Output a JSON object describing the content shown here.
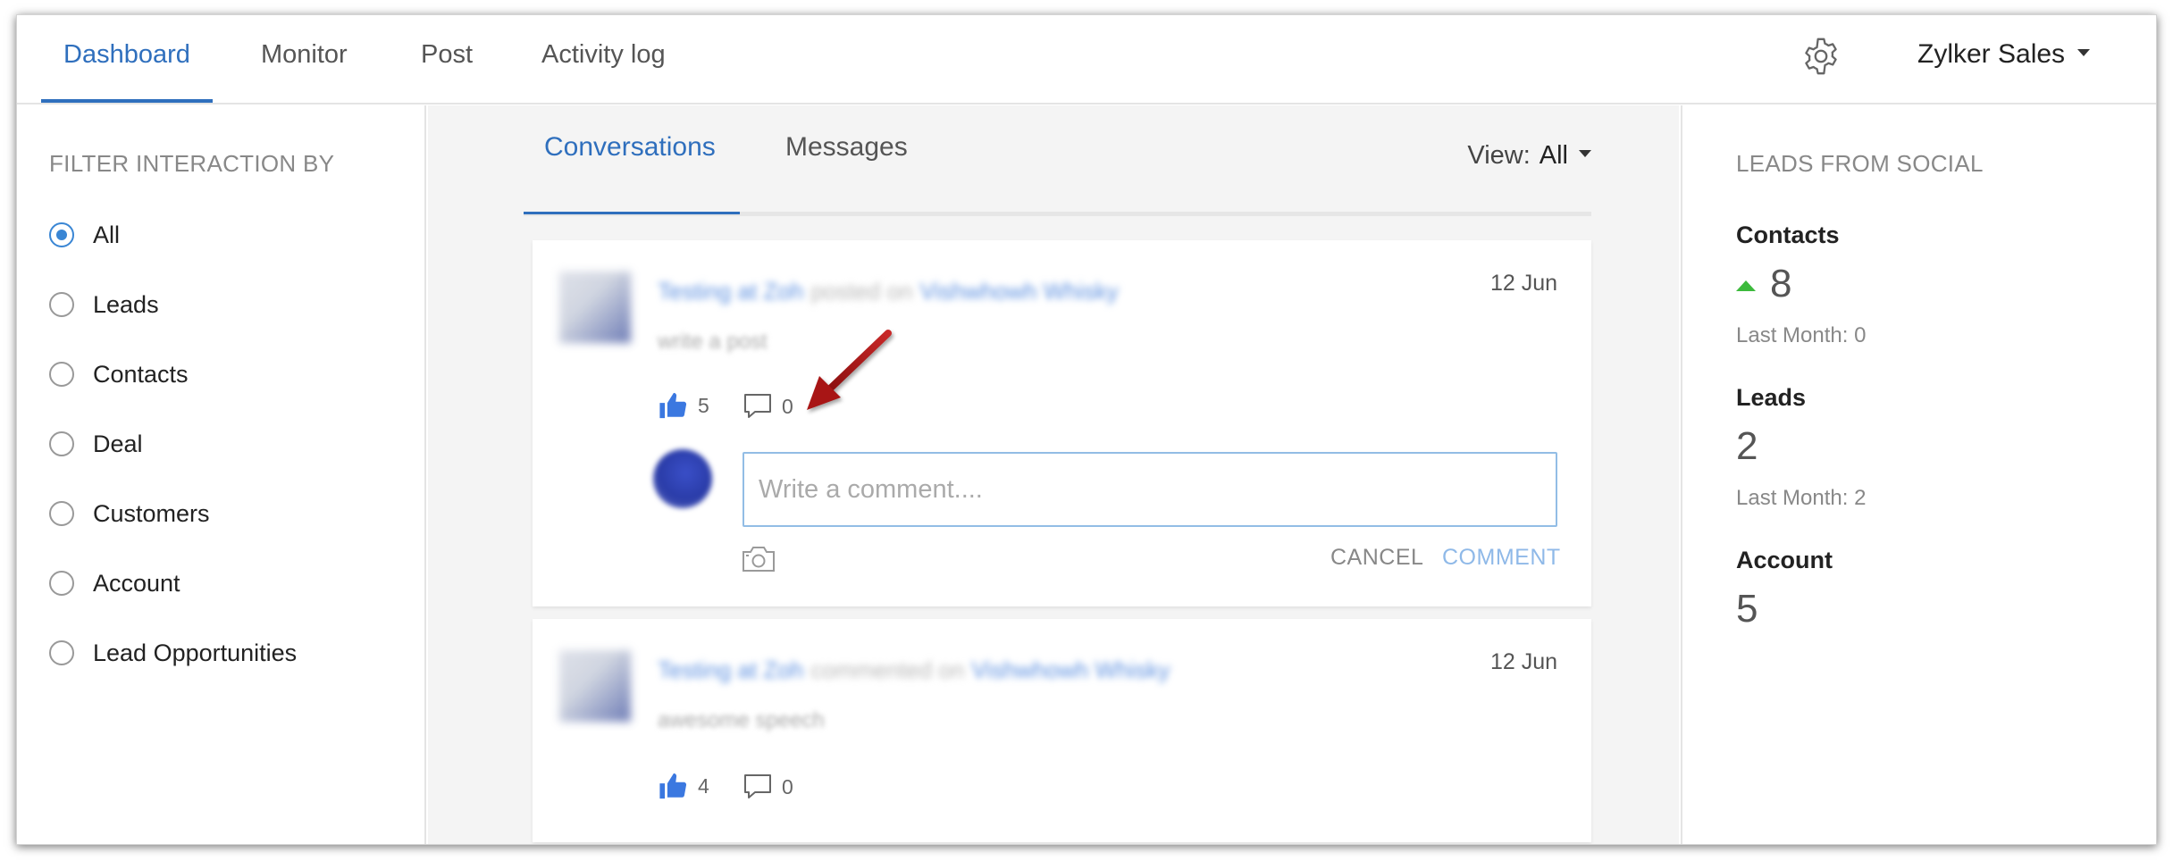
{
  "nav": {
    "tabs": [
      {
        "label": "Dashboard",
        "active": true
      },
      {
        "label": "Monitor"
      },
      {
        "label": "Post"
      },
      {
        "label": "Activity log"
      }
    ],
    "settings_icon": "gear-icon",
    "account_name": "Zylker Sales"
  },
  "filter": {
    "heading": "FILTER INTERACTION BY",
    "selected": "All",
    "options": [
      "All",
      "Leads",
      "Contacts",
      "Deal",
      "Customers",
      "Account",
      "Lead Opportunities"
    ]
  },
  "center": {
    "tabs": [
      {
        "label": "Conversations",
        "active": true
      },
      {
        "label": "Messages"
      }
    ],
    "view_label": "View:",
    "view_value": "All",
    "posts": [
      {
        "author": "Testing at Zoh",
        "action": "posted on",
        "page": "Vishwhowh Whisky",
        "body": "write a post",
        "date": "12 Jun",
        "likes": "5",
        "comments": "0",
        "composer": {
          "placeholder": "Write a comment....",
          "cancel_label": "CANCEL",
          "submit_label": "COMMENT"
        }
      },
      {
        "author": "Testing at Zoh",
        "action": "commented on",
        "page": "Vishwhowh Whisky",
        "body": "awesome speech",
        "date": "12 Jun",
        "likes": "4",
        "comments": "0"
      }
    ]
  },
  "leads_panel": {
    "heading": "LEADS FROM SOCIAL",
    "contacts": {
      "label": "Contacts",
      "value": "8",
      "trend": "up",
      "last_month": "Last Month: 0"
    },
    "leads": {
      "label": "Leads",
      "value": "2",
      "last_month": "Last Month: 2"
    },
    "account": {
      "label": "Account",
      "value": "5"
    }
  },
  "colors": {
    "accent": "#2f6fbd",
    "trend_up": "#3cba3c",
    "annotation": "#b01818"
  }
}
